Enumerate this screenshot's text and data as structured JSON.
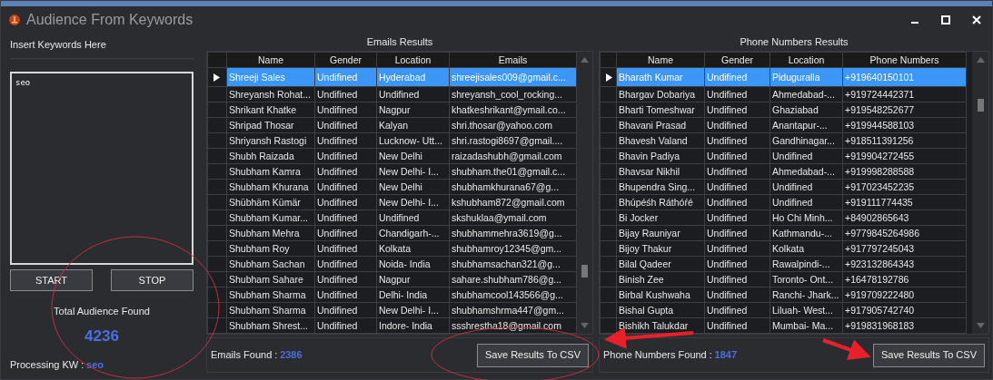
{
  "window": {
    "title": "Audience From Keywords"
  },
  "keywords": {
    "label": "Insert Keywords Here",
    "value": "seo"
  },
  "buttons": [
    "START",
    "STOP"
  ],
  "total": {
    "label": "Total Audience Found",
    "value": "4236"
  },
  "processing": {
    "label": "Processing KW :",
    "value": "seo"
  },
  "emails": {
    "title": "Emails Results",
    "columns": [
      "Name",
      "Gender",
      "Location",
      "Emails"
    ],
    "rows": [
      {
        "cells": [
          "Shreeji Sales",
          "Undifined",
          "Hyderabad",
          "shreejisales009@gmail.c..."
        ],
        "selected": true
      },
      {
        "cells": [
          "Shreyansh Rohat...",
          "Undifined",
          "Undifined",
          "shreyansh_cool_rocking..."
        ],
        "selected": false
      },
      {
        "cells": [
          "Shrikant Khatke",
          "Undifined",
          "Nagpur",
          "khatkeshrikant@ymail.co..."
        ],
        "selected": false
      },
      {
        "cells": [
          "Shripad Thosar",
          "Undifined",
          "Kalyan",
          "shri.thosar@yahoo.com"
        ],
        "selected": false
      },
      {
        "cells": [
          "Shriyansh Rastogi",
          "Undifined",
          "Lucknow- Utt...",
          "shri.rastogi8697@gmail...."
        ],
        "selected": false
      },
      {
        "cells": [
          "Shubh Raizada",
          "Undifined",
          "New Delhi",
          "raizadashubh@gmail.com"
        ],
        "selected": false
      },
      {
        "cells": [
          "Shubham Kamra",
          "Undifined",
          "New Delhi- I...",
          "shubham.the01@gmail.c..."
        ],
        "selected": false
      },
      {
        "cells": [
          "Shubham Khurana",
          "Undifined",
          "New Delhi",
          "shubhamkhurana67@g..."
        ],
        "selected": false
      },
      {
        "cells": [
          "Shübhäm Kümär",
          "Undifined",
          "New Delhi- I...",
          "kshubham872@gmail.com"
        ],
        "selected": false
      },
      {
        "cells": [
          "Shubham Kumar...",
          "Undifined",
          "Undifined",
          "skshuklaa@ymail.com"
        ],
        "selected": false
      },
      {
        "cells": [
          "Shubham Mehra",
          "Undifined",
          "Chandigarh-...",
          "shubhammehra3619@g..."
        ],
        "selected": false
      },
      {
        "cells": [
          "Shubham Roy",
          "Undifined",
          "Kolkata",
          "shubhamroy12345@gm..."
        ],
        "selected": false
      },
      {
        "cells": [
          "Shubham Sachan",
          "Undifined",
          "Noida- India",
          "shubhamsachan321@g..."
        ],
        "selected": false
      },
      {
        "cells": [
          "Shubham Sahare",
          "Undifined",
          "Nagpur",
          "sahare.shubham786@g..."
        ],
        "selected": false
      },
      {
        "cells": [
          "Shubham Sharma",
          "Undifined",
          "Delhi- India",
          "shubhamcool143566@g..."
        ],
        "selected": false
      },
      {
        "cells": [
          "Shubham Sharma",
          "Undifined",
          "New Delhi- I...",
          "shubhamshrma447@gm..."
        ],
        "selected": false
      },
      {
        "cells": [
          "Shubham Shrest...",
          "Undifined",
          "Indore- India",
          "ssshrestha18@gmail.com"
        ],
        "selected": false
      }
    ],
    "found_label": "Emails Found :",
    "found_value": "2386",
    "save_button": "Save Results To CSV"
  },
  "phones": {
    "title": "Phone Numbers Results",
    "columns": [
      "Name",
      "Gender",
      "Location",
      "Phone Numbers"
    ],
    "rows": [
      {
        "cells": [
          "Bharath Kumar",
          "Undifined",
          "Piduguralla",
          "+919640150101"
        ],
        "selected": true
      },
      {
        "cells": [
          "Bhargav Dobariya",
          "Undifined",
          "Ahmedabad-...",
          "+919724442371"
        ],
        "selected": false
      },
      {
        "cells": [
          "Bharti Tomeshwar",
          "Undifined",
          "Ghaziabad",
          "+919548252677"
        ],
        "selected": false
      },
      {
        "cells": [
          "Bhavani Prasad",
          "Undifined",
          "Anantapur-...",
          "+919944588103"
        ],
        "selected": false
      },
      {
        "cells": [
          "Bhavesh Valand",
          "Undifined",
          "Gandhinagar...",
          "+918511391256"
        ],
        "selected": false
      },
      {
        "cells": [
          "Bhavin Padiya",
          "Undifined",
          "Undifined",
          "+919904272455"
        ],
        "selected": false
      },
      {
        "cells": [
          "Bhavsar Nikhil",
          "Undifined",
          "Ahmedabad-...",
          "+919998288588"
        ],
        "selected": false
      },
      {
        "cells": [
          "Bhupendra Sing...",
          "Undifined",
          "Undifined",
          "+917023452235"
        ],
        "selected": false
      },
      {
        "cells": [
          "Bhúpéśh Ráthóŕé",
          "Undifined",
          "Undifined",
          "+919111774435"
        ],
        "selected": false
      },
      {
        "cells": [
          "Bi Jocker",
          "Undifined",
          "Ho Chi Minh...",
          "+84902865643"
        ],
        "selected": false
      },
      {
        "cells": [
          "Bijay Rauniyar",
          "Undifined",
          "Kathmandu-...",
          "+9779845264986"
        ],
        "selected": false
      },
      {
        "cells": [
          "Bijoy Thakur",
          "Undifined",
          "Kolkata",
          "+917797245043"
        ],
        "selected": false
      },
      {
        "cells": [
          "Bilal Qadeer",
          "Undifined",
          "Rawalpindi-...",
          "+923132864343"
        ],
        "selected": false
      },
      {
        "cells": [
          "Binish Zee",
          "Undifined",
          "Toronto- Ont...",
          "+16478192786"
        ],
        "selected": false
      },
      {
        "cells": [
          "Birbal Kushwaha",
          "Undifined",
          "Ranchi- Jhark...",
          "+919709222480"
        ],
        "selected": false
      },
      {
        "cells": [
          "Bishal Gupta",
          "Undifined",
          "Liluah- West...",
          "+917905742740"
        ],
        "selected": false
      },
      {
        "cells": [
          "Bishikh Talukdar",
          "Undifined",
          "Mumbai- Ma...",
          "+919831968183"
        ],
        "selected": false
      }
    ],
    "found_label": "Phone Numbers Found :",
    "found_value": "1847",
    "save_button": "Save Results To CSV"
  }
}
